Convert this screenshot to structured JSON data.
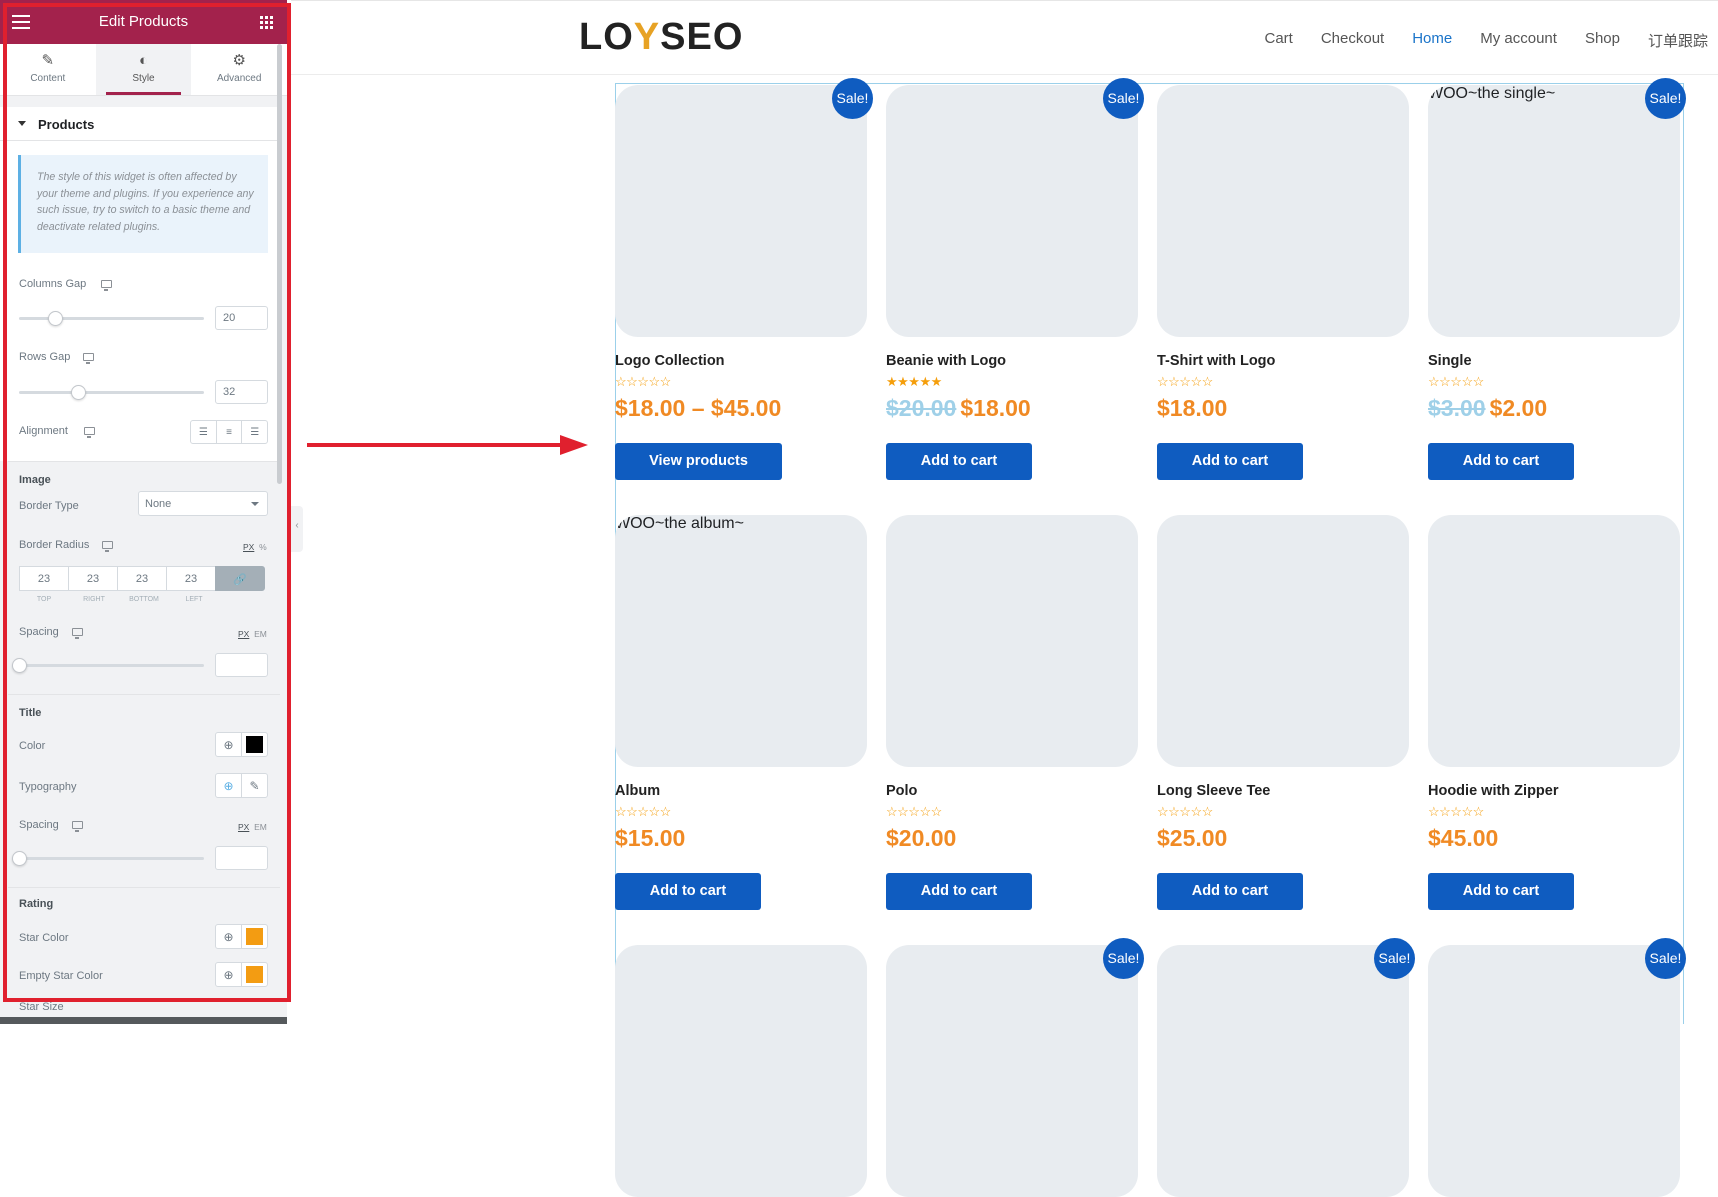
{
  "panel": {
    "title": "Edit Products",
    "tabs": [
      {
        "label": "Content",
        "icon": "pencil-icon"
      },
      {
        "label": "Style",
        "icon": "half-circle-icon"
      },
      {
        "label": "Advanced",
        "icon": "gear-icon"
      }
    ],
    "active_tab": "Style",
    "section_title": "Products",
    "notice": "The style of this widget is often affected by your theme and plugins. If you experience any such issue, try to switch to a basic theme and deactivate related plugins.",
    "columns_gap": {
      "label": "Columns Gap",
      "value": "20",
      "slider": 0.2
    },
    "rows_gap": {
      "label": "Rows Gap",
      "value": "32",
      "slider": 0.32
    },
    "alignment": {
      "label": "Alignment"
    },
    "image": {
      "heading": "Image",
      "border_type": {
        "label": "Border Type",
        "value": "None"
      },
      "border_radius": {
        "label": "Border Radius",
        "unit_px": "PX",
        "unit_pct": "%",
        "values": [
          "23",
          "23",
          "23",
          "23"
        ],
        "sides": [
          "TOP",
          "RIGHT",
          "BOTTOM",
          "LEFT"
        ]
      },
      "spacing": {
        "label": "Spacing",
        "unit_px": "PX",
        "unit_em": "EM"
      }
    },
    "title_section": {
      "heading": "Title",
      "color_label": "Color",
      "color_value": "#000000",
      "typography_label": "Typography",
      "spacing_label": "Spacing",
      "unit_px": "PX",
      "unit_em": "EM"
    },
    "rating": {
      "heading": "Rating",
      "star_color_label": "Star Color",
      "star_color": "#f39c12",
      "empty_star_color_label": "Empty Star Color",
      "empty_star_color": "#f39c12",
      "star_size_label": "Star Size"
    },
    "colors": {
      "header": "#a3224c",
      "highlight_frame": "#e0202e"
    }
  },
  "site": {
    "logo": {
      "part1": "LO",
      "part2": "Y",
      "part3": "SEO"
    },
    "nav": [
      {
        "label": "Cart",
        "active": false
      },
      {
        "label": "Checkout",
        "active": false
      },
      {
        "label": "Home",
        "active": true
      },
      {
        "label": "My account",
        "active": false
      },
      {
        "label": "Shop",
        "active": false
      },
      {
        "label": "订单跟踪",
        "active": false
      }
    ],
    "accent_color": "#0f5cc0",
    "price_color": "#f08a24",
    "products": [
      {
        "title": "Logo Collection",
        "sale": true,
        "rating": 0,
        "old_price": "",
        "price": "$18.00 – $45.00",
        "button": "View products",
        "image": "logo-collection-image"
      },
      {
        "title": "Beanie with Logo",
        "sale": true,
        "rating": 5,
        "old_price": "$20.00",
        "price": "$18.00",
        "button": "Add to cart",
        "image": "beanie-image"
      },
      {
        "title": "T-Shirt with Logo",
        "sale": false,
        "rating": 0,
        "old_price": "",
        "price": "$18.00",
        "button": "Add to cart",
        "image": "tshirt-image"
      },
      {
        "title": "Single",
        "sale": true,
        "rating": 0,
        "old_price": "$3.00",
        "price": "$2.00",
        "button": "Add to cart",
        "image": "woo-single-image"
      },
      {
        "title": "Album",
        "sale": false,
        "rating": 0,
        "old_price": "",
        "price": "$15.00",
        "button": "Add to cart",
        "image": "woo-album-image"
      },
      {
        "title": "Polo",
        "sale": false,
        "rating": 0,
        "old_price": "",
        "price": "$20.00",
        "button": "Add to cart",
        "image": "polo-image"
      },
      {
        "title": "Long Sleeve Tee",
        "sale": false,
        "rating": 0,
        "old_price": "",
        "price": "$25.00",
        "button": "Add to cart",
        "image": "long-sleeve-image"
      },
      {
        "title": "Hoodie with Zipper",
        "sale": false,
        "rating": 0,
        "old_price": "",
        "price": "$45.00",
        "button": "Add to cart",
        "image": "hoodie-zipper-image"
      },
      {
        "title": "",
        "sale": false,
        "image": "partial-image"
      },
      {
        "title": "",
        "sale": true,
        "image": "partial-image"
      },
      {
        "title": "",
        "sale": true,
        "image": "partial-image"
      },
      {
        "title": "",
        "sale": true,
        "image": "partial-image"
      }
    ],
    "sale_badge": "Sale!"
  }
}
